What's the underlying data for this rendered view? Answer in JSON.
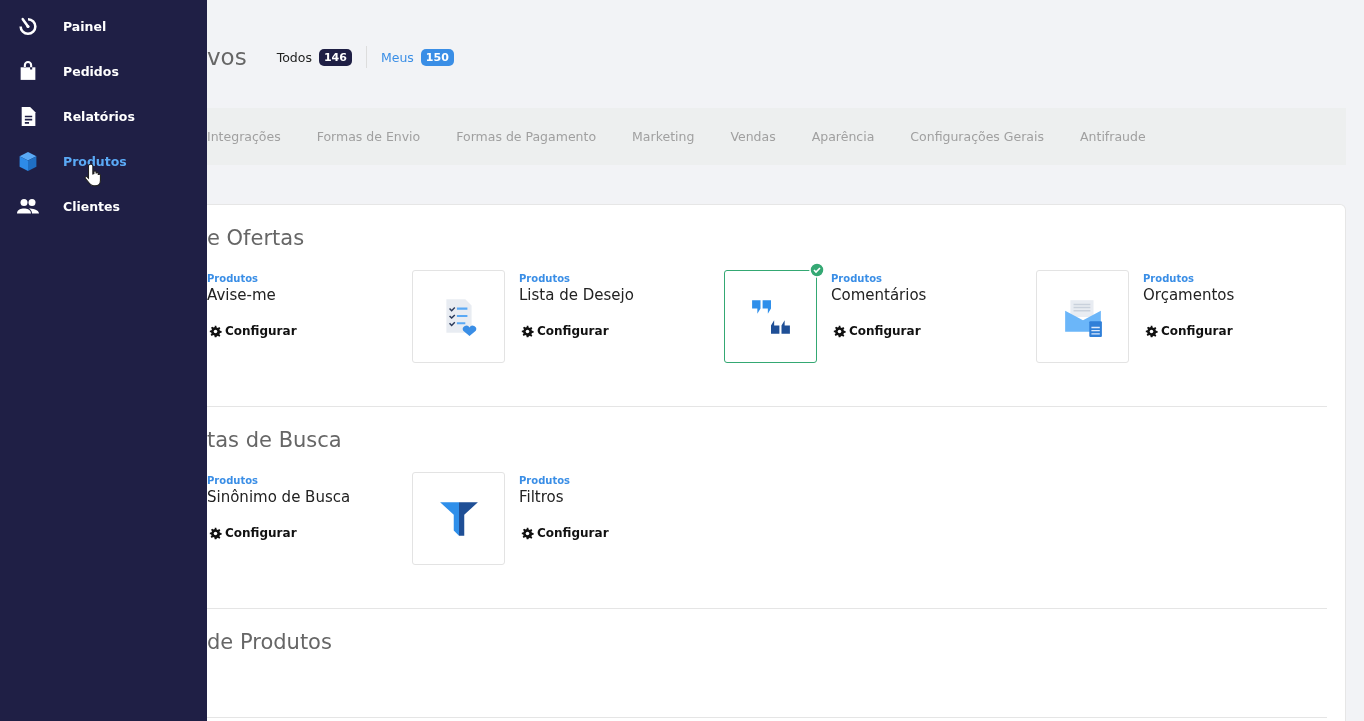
{
  "sidebar": {
    "items": [
      {
        "label": "Painel",
        "kind": "timer",
        "selected": false
      },
      {
        "label": "Pedidos",
        "kind": "bag",
        "selected": false
      },
      {
        "label": "Relatórios",
        "kind": "doc",
        "selected": false
      },
      {
        "label": "Produtos",
        "kind": "box",
        "selected": true
      },
      {
        "label": "Clientes",
        "kind": "people",
        "selected": false
      }
    ]
  },
  "header": {
    "title": "vos",
    "filters": [
      {
        "label": "Todos",
        "count": "146",
        "selected": false
      },
      {
        "label": "Meus",
        "count": "150",
        "selected": true
      }
    ]
  },
  "category_tabs": [
    "Integrações",
    "Formas de Envio",
    "Formas de Pagamento",
    "Marketing",
    "Vendas",
    "Aparência",
    "Configurações Gerais",
    "Antifraude"
  ],
  "sections": [
    {
      "title": "e Ofertas",
      "apps": [
        {
          "category": "Produtos",
          "name": "Avise-me",
          "action": "Configurar",
          "kind": "covered"
        },
        {
          "category": "Produtos",
          "name": "Lista de Desejo",
          "action": "Configurar",
          "kind": "checklist",
          "installed": false
        },
        {
          "category": "Produtos",
          "name": "Comentários",
          "action": "Configurar",
          "kind": "quotes",
          "installed": true
        },
        {
          "category": "Produtos",
          "name": "Orçamentos",
          "action": "Configurar",
          "kind": "envelope",
          "installed": false
        }
      ]
    },
    {
      "title": "tas de Busca",
      "apps": [
        {
          "category": "Produtos",
          "name": "Sinônimo de Busca",
          "action": "Configurar",
          "kind": "covered"
        },
        {
          "category": "Produtos",
          "name": "Filtros",
          "action": "Configurar",
          "kind": "funnel",
          "installed": false
        }
      ]
    },
    {
      "title": "de Produtos"
    }
  ]
}
